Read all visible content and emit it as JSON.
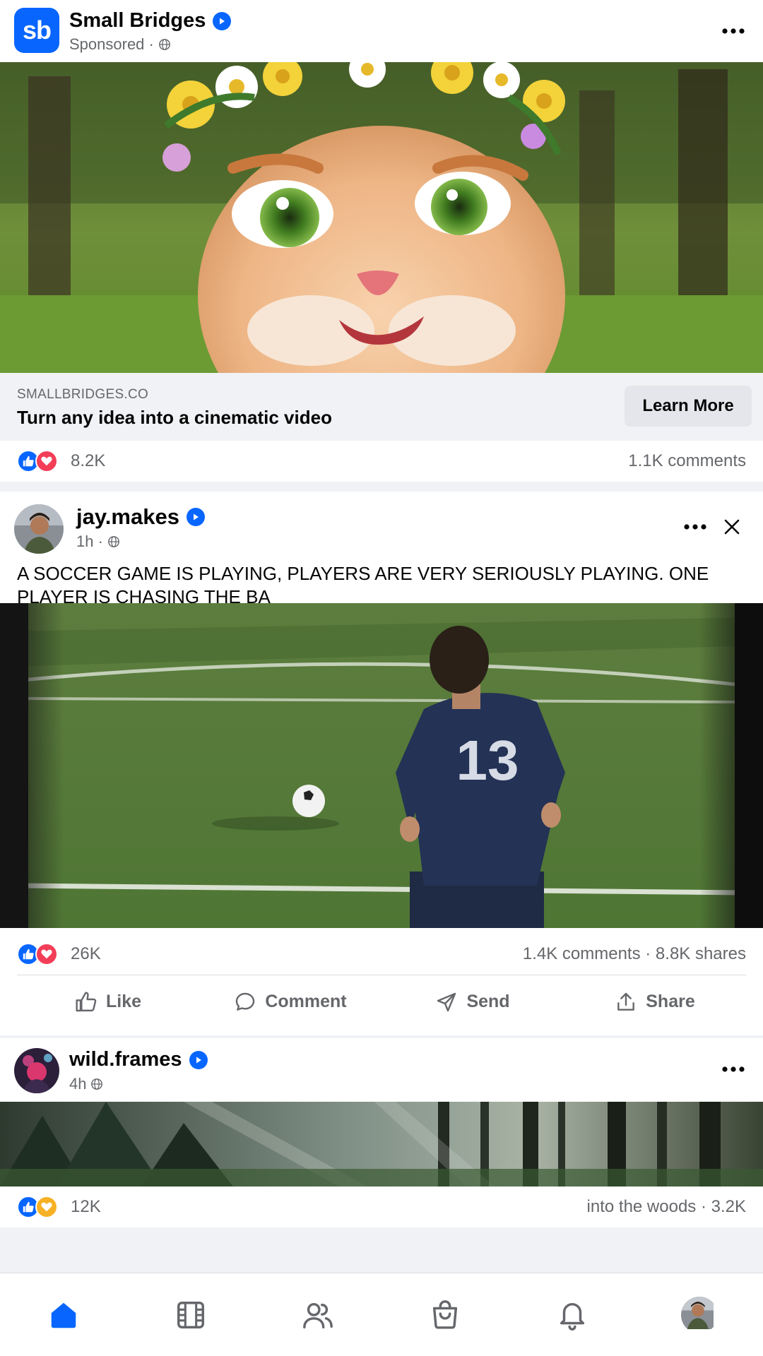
{
  "colors": {
    "brand": "#0866ff",
    "secondary_text": "#65676b",
    "like": "#0866ff",
    "love": "#f33e58",
    "care": "#f7b125"
  },
  "ad_post": {
    "brand_initials": "sb",
    "author": "Small Bridges",
    "meta": "Sponsored ·",
    "domain": "SMALLBRIDGES.CO",
    "headline": "Turn any idea into a cinematic video",
    "cta": "Learn More",
    "reaction_count": "8.2K",
    "comments": "1.1K comments",
    "media_icon": "cartoon-cat-flower-crown-image"
  },
  "post2": {
    "author": "jay.makes",
    "meta": "1h ·",
    "caption": "A SOCCER GAME IS PLAYING, PLAYERS ARE VERY SERIOUSLY PLAYING. ONE PLAYER IS CHASING THE BA",
    "jersey_number": "13",
    "reaction_count": "26K",
    "stats": "1.4K comments · 8.8K shares",
    "actions": {
      "like": "Like",
      "comment": "Comment",
      "send": "Send",
      "share": "Share"
    }
  },
  "post3": {
    "author": "wild.frames",
    "meta": "4h",
    "reaction_count": "12K",
    "stats": "into the woods · 3.2K"
  },
  "nav": {
    "items": [
      "home-icon",
      "video-icon",
      "friends-icon",
      "marketplace-icon",
      "notifications-icon",
      "profile-avatar"
    ],
    "active": "home-icon"
  }
}
